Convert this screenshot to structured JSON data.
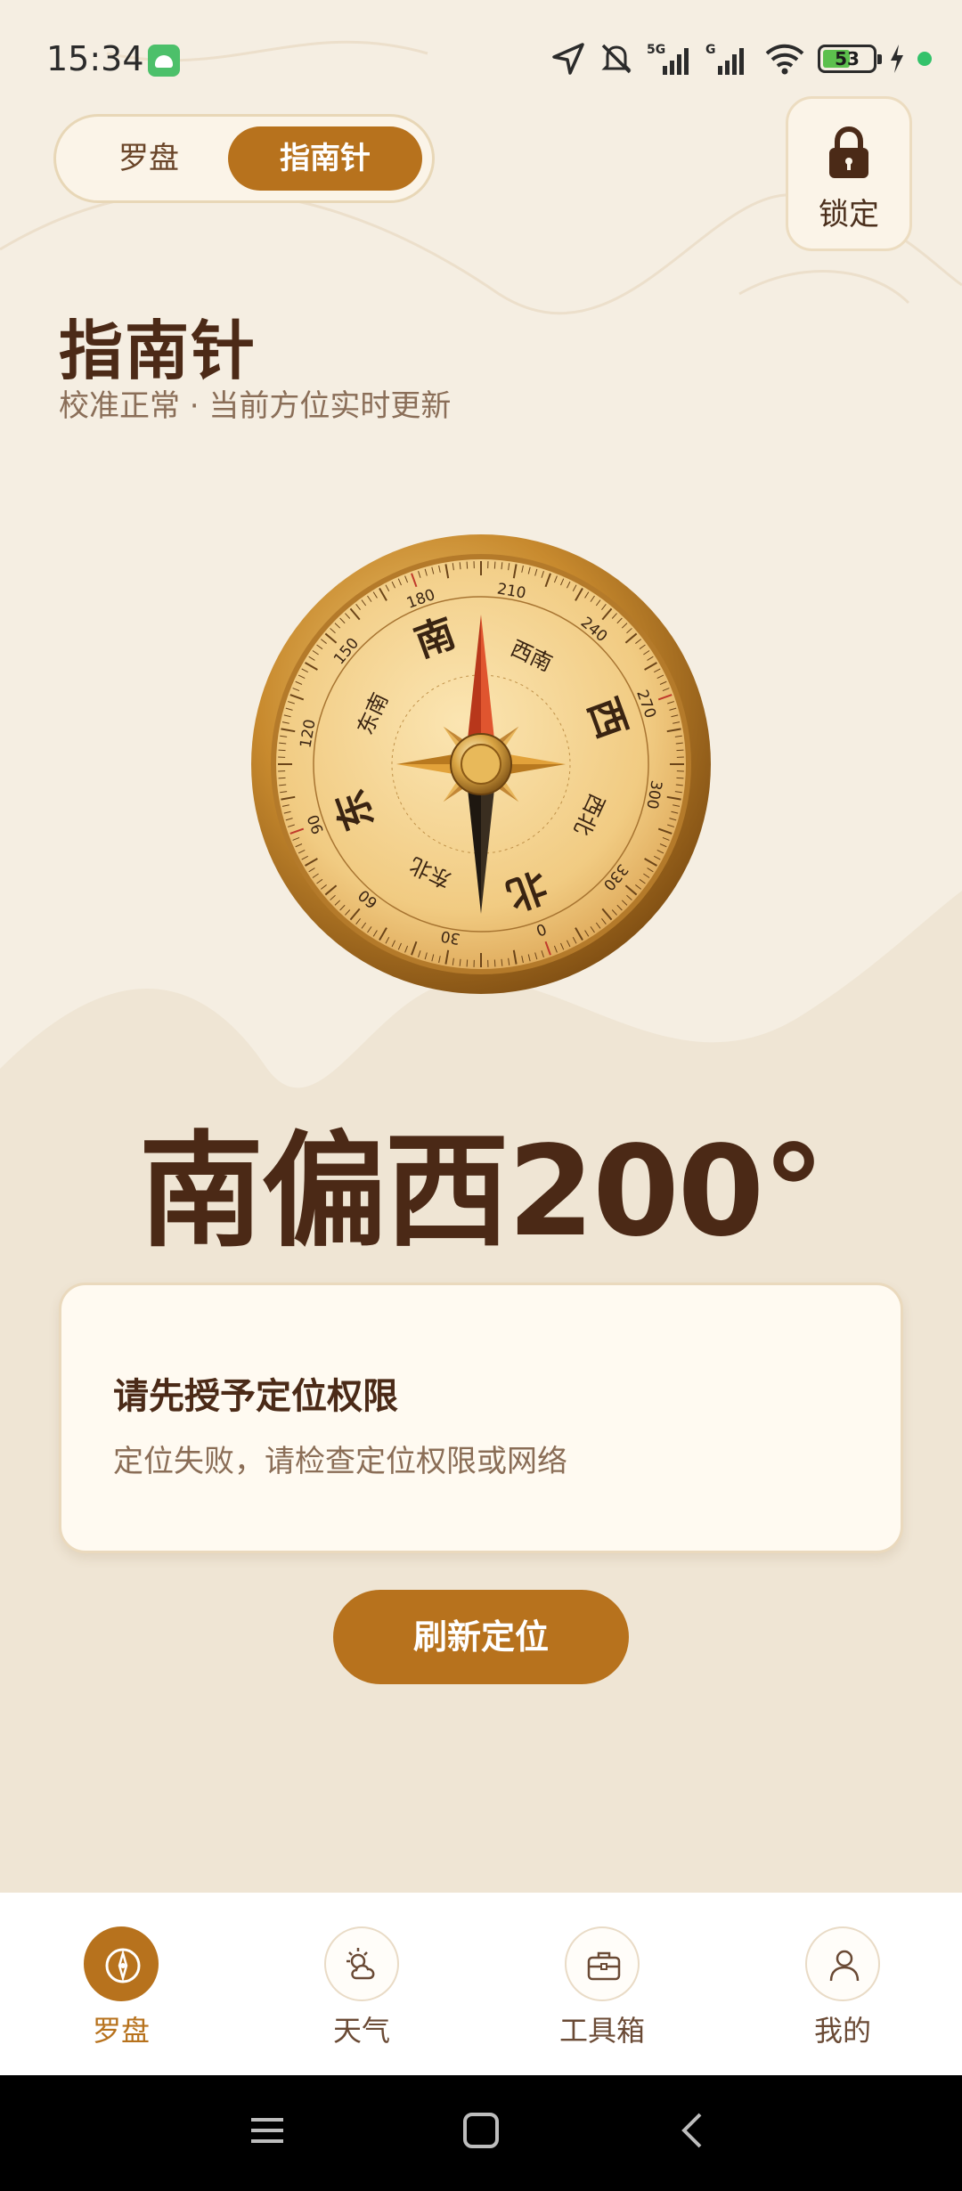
{
  "status_bar": {
    "time": "15:34",
    "battery_percent": "53",
    "network_labels": [
      "5G",
      "G"
    ]
  },
  "mode_toggle": {
    "options": [
      "罗盘",
      "指南针"
    ],
    "selected": "指南针"
  },
  "lock_button": {
    "label": "锁定",
    "icon": "lock-icon"
  },
  "header": {
    "title": "指南针",
    "subtitle": "校准正常 · 当前方位实时更新"
  },
  "compass": {
    "rotation_degrees": 200,
    "cardinals": {
      "north": "北",
      "south": "南",
      "east": "东",
      "west": "西"
    },
    "intercardinals": {
      "northeast": "东北",
      "northwest": "西北",
      "southeast": "东南",
      "southwest": "西南"
    },
    "degree_labels": [
      "0",
      "30",
      "60",
      "90",
      "120",
      "150",
      "180",
      "210",
      "240",
      "270",
      "300",
      "330"
    ],
    "colors": {
      "rim": "#c88a2e",
      "face": "#f3d28f",
      "needle_north": "#d54b2b",
      "needle_south": "#2a2016"
    }
  },
  "heading_text": "南偏西200°",
  "permission_card": {
    "title": "请先授予定位权限",
    "description": "定位失败，请检查定位权限或网络"
  },
  "refresh_button": {
    "label": "刷新定位"
  },
  "bottom_nav": {
    "items": [
      {
        "label": "罗盘",
        "icon": "compass-icon",
        "active": true
      },
      {
        "label": "天气",
        "icon": "weather-icon",
        "active": false
      },
      {
        "label": "工具箱",
        "icon": "toolbox-icon",
        "active": false
      },
      {
        "label": "我的",
        "icon": "profile-icon",
        "active": false
      }
    ]
  },
  "theme": {
    "accent": "#b7721d",
    "background": "#f5eee2",
    "text_dark": "#4b2916"
  }
}
